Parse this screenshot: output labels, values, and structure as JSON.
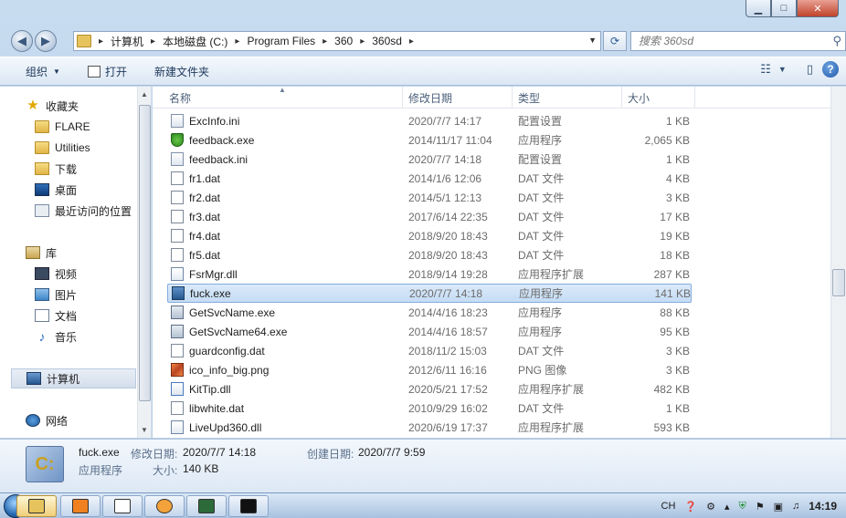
{
  "window": {
    "minimize": "▁",
    "maximize": "□",
    "close": "✕"
  },
  "address": {
    "crumbs": [
      "计算机",
      "本地磁盘 (C:)",
      "Program Files",
      "360",
      "360sd"
    ],
    "separator": "▸"
  },
  "search": {
    "placeholder": "搜索 360sd"
  },
  "toolbar": {
    "organize": "组织",
    "open": "打开",
    "new_folder": "新建文件夹"
  },
  "nav": {
    "favorites": "收藏夹",
    "fav_items": [
      "FLARE",
      "Utilities",
      "下载",
      "桌面",
      "最近访问的位置"
    ],
    "libraries": "库",
    "lib_items": [
      "视频",
      "图片",
      "文档",
      "音乐"
    ],
    "computer": "计算机",
    "network": "网络"
  },
  "columns": {
    "name": "名称",
    "date": "修改日期",
    "type": "类型",
    "size": "大小"
  },
  "files": [
    {
      "name": "ExcInfo.ini",
      "date": "2020/7/7 14:17",
      "type": "配置设置",
      "size": "1 KB",
      "icon": "ini"
    },
    {
      "name": "feedback.exe",
      "date": "2014/11/17 11:04",
      "type": "应用程序",
      "size": "2,065 KB",
      "icon": "shield"
    },
    {
      "name": "feedback.ini",
      "date": "2020/7/7 14:18",
      "type": "配置设置",
      "size": "1 KB",
      "icon": "ini"
    },
    {
      "name": "fr1.dat",
      "date": "2014/1/6 12:06",
      "type": "DAT 文件",
      "size": "4 KB",
      "icon": "blank"
    },
    {
      "name": "fr2.dat",
      "date": "2014/5/1 12:13",
      "type": "DAT 文件",
      "size": "3 KB",
      "icon": "blank"
    },
    {
      "name": "fr3.dat",
      "date": "2017/6/14 22:35",
      "type": "DAT 文件",
      "size": "17 KB",
      "icon": "blank"
    },
    {
      "name": "fr4.dat",
      "date": "2018/9/20 18:43",
      "type": "DAT 文件",
      "size": "19 KB",
      "icon": "blank"
    },
    {
      "name": "fr5.dat",
      "date": "2018/9/20 18:43",
      "type": "DAT 文件",
      "size": "18 KB",
      "icon": "blank"
    },
    {
      "name": "FsrMgr.dll",
      "date": "2018/9/14 19:28",
      "type": "应用程序扩展",
      "size": "287 KB",
      "icon": "dll"
    },
    {
      "name": "fuck.exe",
      "date": "2020/7/7 14:18",
      "type": "应用程序",
      "size": "141 KB",
      "icon": "exe",
      "selected": true
    },
    {
      "name": "GetSvcName.exe",
      "date": "2014/4/16 18:23",
      "type": "应用程序",
      "size": "88 KB",
      "icon": "exe2"
    },
    {
      "name": "GetSvcName64.exe",
      "date": "2014/4/16 18:57",
      "type": "应用程序",
      "size": "95 KB",
      "icon": "exe2"
    },
    {
      "name": "guardconfig.dat",
      "date": "2018/11/2 15:03",
      "type": "DAT 文件",
      "size": "3 KB",
      "icon": "blank"
    },
    {
      "name": "ico_info_big.png",
      "date": "2012/6/11 16:16",
      "type": "PNG 图像",
      "size": "3 KB",
      "icon": "png"
    },
    {
      "name": "KitTip.dll",
      "date": "2020/5/21 17:52",
      "type": "应用程序扩展",
      "size": "482 KB",
      "icon": "kit"
    },
    {
      "name": "libwhite.dat",
      "date": "2010/9/29 16:02",
      "type": "DAT 文件",
      "size": "1 KB",
      "icon": "blank"
    },
    {
      "name": "LiveUpd360.dll",
      "date": "2020/6/19 17:37",
      "type": "应用程序扩展",
      "size": "593 KB",
      "icon": "dll"
    }
  ],
  "details": {
    "name": "fuck.exe",
    "modified_label": "修改日期:",
    "modified": "2020/7/7 14:18",
    "created_label": "创建日期:",
    "created": "2020/7/7 9:59",
    "type": "应用程序",
    "size_label": "大小:",
    "size": "140 KB"
  },
  "taskbar": {
    "lang": "CH",
    "time": "14:19"
  }
}
